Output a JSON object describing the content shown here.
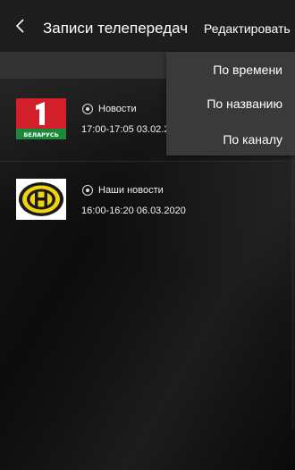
{
  "header": {
    "title": "Записи телепередач",
    "edit_label": "Редактировать"
  },
  "sort_menu": {
    "items": [
      {
        "label": "По времени"
      },
      {
        "label": "По названию"
      },
      {
        "label": "По каналу"
      }
    ]
  },
  "recordings": [
    {
      "channel_logo": "belarus-1-logo",
      "logo_text": "БЕЛАРУСЬ",
      "program": "Новости",
      "time": "17:00-17:05 03.02.2"
    },
    {
      "channel_logo": "ont-logo",
      "program": "Наши новости",
      "time": "16:00-16:20 06.03.2020"
    }
  ],
  "colors": {
    "header_bg": "#1d1d1d",
    "menu_bg": "#3a3a3a",
    "belarus_red": "#c8102e",
    "ont_yellow": "#f2d40b"
  }
}
